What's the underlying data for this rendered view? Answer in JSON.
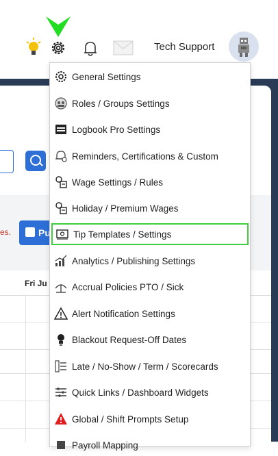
{
  "header": {
    "user_name": "Tech Support",
    "icons": [
      "lightbulb-icon",
      "gear-icon",
      "bell-icon",
      "mail-icon",
      "robot-avatar-icon"
    ]
  },
  "background": {
    "publish_label": "Pu",
    "notice_fragment": "es.",
    "day_label": "Fri Ju"
  },
  "settings_menu": {
    "items": [
      {
        "label": "General Settings",
        "icon": "gear-icon"
      },
      {
        "label": "Roles / Groups Settings",
        "icon": "roles-icon"
      },
      {
        "label": "Logbook Pro Settings",
        "icon": "logbook-icon"
      },
      {
        "label": "Reminders, Certifications & Custom",
        "icon": "reminder-icon"
      },
      {
        "label": "Wage Settings / Rules",
        "icon": "wage-icon"
      },
      {
        "label": "Holiday / Premium Wages",
        "icon": "holiday-wage-icon"
      },
      {
        "label": "Tip Templates / Settings",
        "icon": "tip-icon"
      },
      {
        "label": "Analytics / Publishing Settings",
        "icon": "analytics-icon"
      },
      {
        "label": "Accrual Policies PTO / Sick",
        "icon": "accrual-icon"
      },
      {
        "label": "Alert Notification Settings",
        "icon": "alert-icon"
      },
      {
        "label": "Blackout Request-Off Dates",
        "icon": "blackout-icon"
      },
      {
        "label": "Late / No-Show / Term / Scorecards",
        "icon": "scorecard-icon"
      },
      {
        "label": "Quick Links / Dashboard Widgets",
        "icon": "quicklinks-icon"
      },
      {
        "label": "Global / Shift Prompts Setup",
        "icon": "warning-icon"
      },
      {
        "label": "Payroll Mapping",
        "icon": "payroll-icon"
      }
    ],
    "selected_index": 6,
    "highlight_color": "#3ecf3e"
  },
  "colors": {
    "accent_blue": "#2d6fd6",
    "arrow_green": "#22dd22",
    "warning_red": "#e02020"
  }
}
